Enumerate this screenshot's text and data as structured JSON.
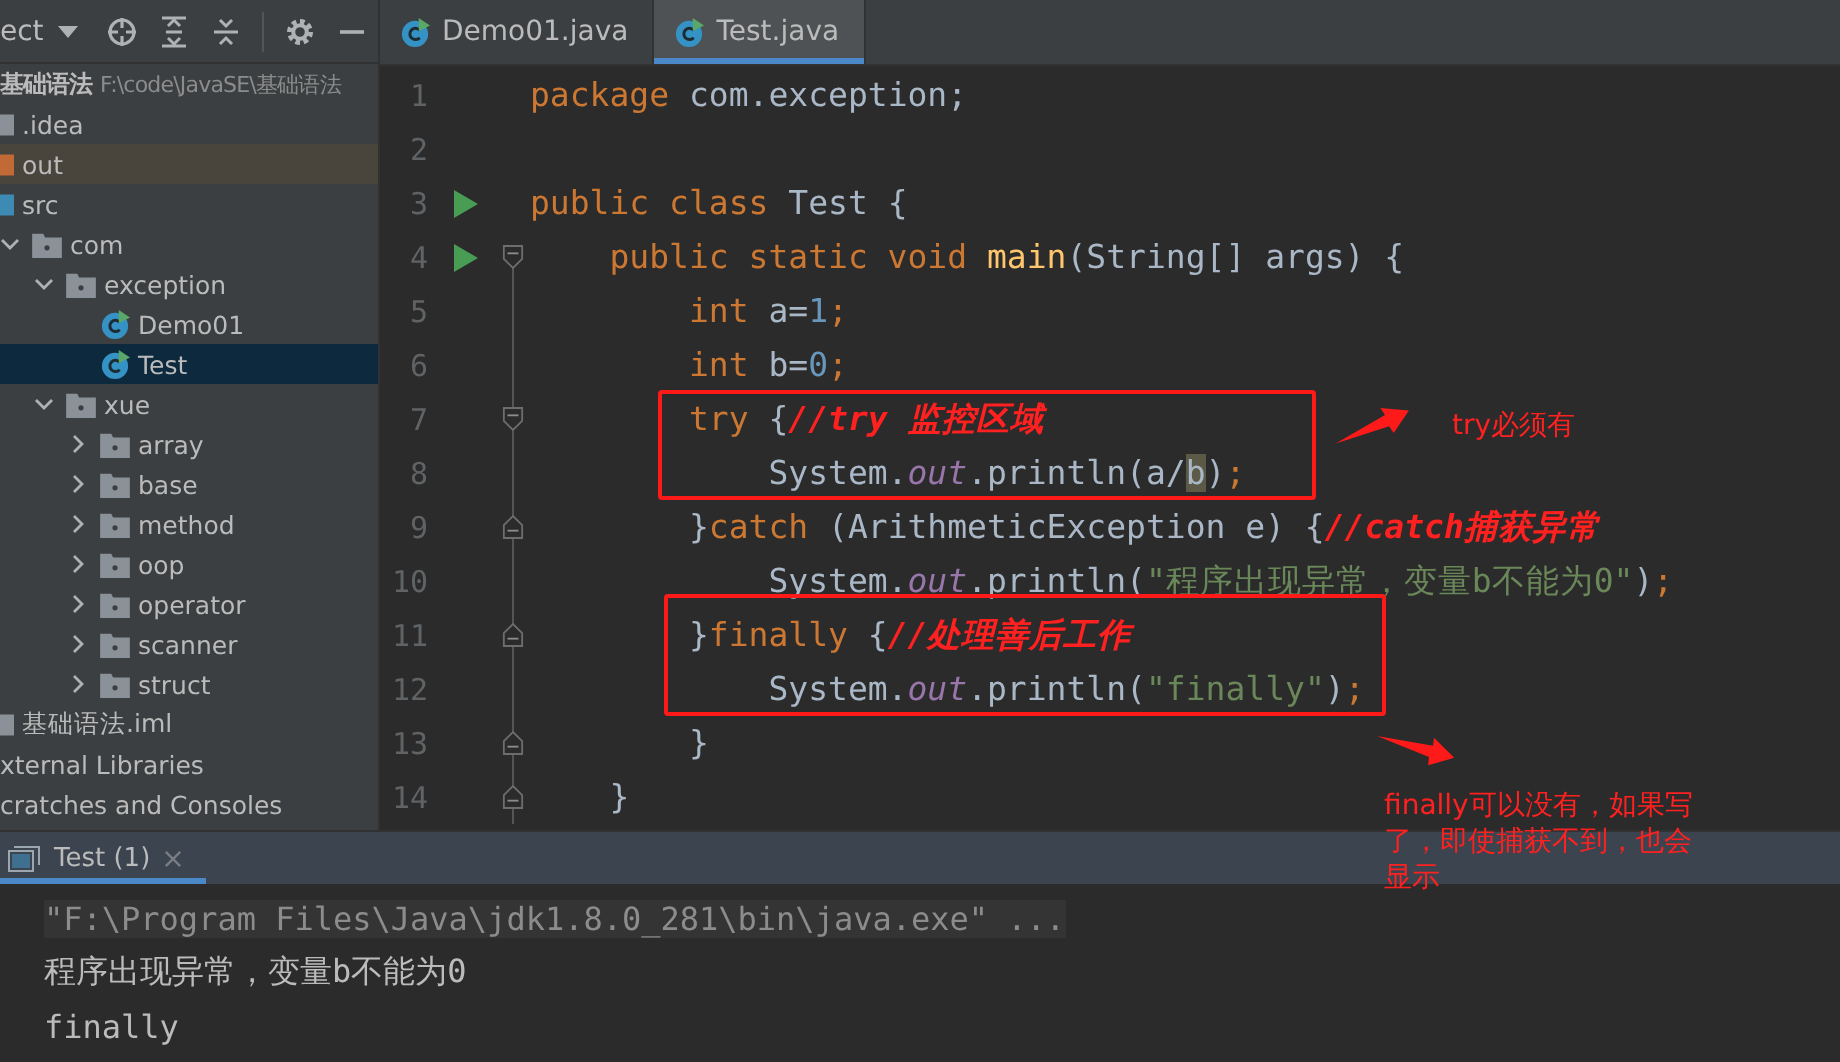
{
  "project_selector": {
    "label": "ect"
  },
  "editor_tabs": [
    {
      "label": "Demo01.java",
      "selected": false
    },
    {
      "label": "Test.java",
      "selected": true
    }
  ],
  "tree": [
    {
      "kind": "project",
      "label": "基础语法",
      "path": "F:\\code\\JavaSE\\基础语法",
      "children": [
        {
          "kind": "folder",
          "label": ".idea",
          "selected": false,
          "highlighted": false
        },
        {
          "kind": "excluded-folder",
          "label": "out",
          "selected": false,
          "highlighted": true
        },
        {
          "kind": "source-folder",
          "label": "src",
          "selected": false,
          "highlighted": false,
          "children": [
            {
              "kind": "package",
              "label": "com",
              "expanded": true,
              "selected": false,
              "highlighted": false,
              "children": [
                {
                  "kind": "package",
                  "label": "exception",
                  "expanded": true,
                  "selected": false,
                  "highlighted": false,
                  "children": [
                    {
                      "kind": "class",
                      "label": "Demo01",
                      "selected": false,
                      "highlighted": false
                    },
                    {
                      "kind": "class",
                      "label": "Test",
                      "selected": true,
                      "highlighted": false
                    }
                  ]
                },
                {
                  "kind": "package",
                  "label": "xue",
                  "expanded": true,
                  "selected": false,
                  "highlighted": false,
                  "children": [
                    {
                      "kind": "package",
                      "label": "array",
                      "expanded": false,
                      "selected": false,
                      "highlighted": false
                    },
                    {
                      "kind": "package",
                      "label": "base",
                      "expanded": false,
                      "selected": false,
                      "highlighted": false
                    },
                    {
                      "kind": "package",
                      "label": "method",
                      "expanded": false,
                      "selected": false,
                      "highlighted": false
                    },
                    {
                      "kind": "package",
                      "label": "oop",
                      "expanded": false,
                      "selected": false,
                      "highlighted": false
                    },
                    {
                      "kind": "package",
                      "label": "operator",
                      "expanded": false,
                      "selected": false,
                      "highlighted": false
                    },
                    {
                      "kind": "package",
                      "label": "scanner",
                      "expanded": false,
                      "selected": false,
                      "highlighted": false
                    },
                    {
                      "kind": "package",
                      "label": "struct",
                      "expanded": false,
                      "selected": false,
                      "highlighted": false
                    }
                  ]
                }
              ]
            }
          ]
        },
        {
          "kind": "iml",
          "label": "基础语法.iml",
          "selected": false,
          "highlighted": false
        }
      ]
    },
    {
      "kind": "plain",
      "label": "xternal Libraries",
      "selected": false,
      "highlighted": false
    },
    {
      "kind": "plain",
      "label": "cratches and Consoles",
      "selected": false,
      "highlighted": false
    }
  ],
  "code_lines": [
    {
      "number": "1",
      "run": false,
      "fold_start": false,
      "fold_end": false,
      "tokens": [
        {
          "kind": "keyword",
          "text": "package"
        },
        {
          "kind": "plain",
          "text": " com.exception;"
        }
      ]
    },
    {
      "number": "2",
      "run": false,
      "fold_start": false,
      "fold_end": false
    },
    {
      "number": "3",
      "run": true,
      "fold_start": false,
      "fold_end": false,
      "tokens": [
        {
          "kind": "keyword",
          "text": "public class"
        },
        {
          "kind": "plain",
          "text": " Test {"
        }
      ]
    },
    {
      "number": "4",
      "run": true,
      "fold_start": true,
      "fold_end": false,
      "tokens": [
        {
          "kind": "keyword",
          "text": "    public static void "
        },
        {
          "kind": "method",
          "text": "main"
        },
        {
          "kind": "plain",
          "text": "(String[] args) {"
        }
      ]
    },
    {
      "number": "5",
      "run": false,
      "fold_start": false,
      "fold_end": false,
      "tokens": [
        {
          "kind": "keyword",
          "text": "        int"
        },
        {
          "kind": "plain",
          "text": " a="
        },
        {
          "kind": "number",
          "text": "1"
        },
        {
          "kind": "keyword",
          "text": ";"
        }
      ]
    },
    {
      "number": "6",
      "run": false,
      "fold_start": false,
      "fold_end": false,
      "tokens": [
        {
          "kind": "keyword",
          "text": "        int"
        },
        {
          "kind": "plain",
          "text": " b="
        },
        {
          "kind": "number",
          "text": "0"
        },
        {
          "kind": "keyword",
          "text": ";"
        }
      ]
    },
    {
      "number": "7",
      "run": false,
      "fold_start": true,
      "fold_end": false,
      "tokens": [
        {
          "kind": "keyword",
          "text": "        try"
        },
        {
          "kind": "plain",
          "text": " {"
        },
        {
          "kind": "note",
          "text": "//try 监控区域"
        }
      ]
    },
    {
      "number": "8",
      "run": false,
      "fold_start": false,
      "fold_end": false,
      "tokens": [
        {
          "kind": "plain",
          "text": "            System."
        },
        {
          "kind": "field",
          "text": "out"
        },
        {
          "kind": "plain",
          "text": ".println(a/"
        },
        {
          "kind": "caret",
          "text": "b"
        },
        {
          "kind": "plain",
          "text": ")"
        },
        {
          "kind": "keyword",
          "text": ";"
        }
      ]
    },
    {
      "number": "9",
      "run": false,
      "fold_start": false,
      "fold_end": true,
      "tokens": [
        {
          "kind": "plain",
          "text": "        }"
        },
        {
          "kind": "keyword",
          "text": "catch"
        },
        {
          "kind": "plain",
          "text": " (ArithmeticException e) {"
        },
        {
          "kind": "note",
          "text": "//catch捕获异常"
        }
      ]
    },
    {
      "number": "10",
      "run": false,
      "fold_start": false,
      "fold_end": false,
      "tokens": [
        {
          "kind": "plain",
          "text": "            System."
        },
        {
          "kind": "field",
          "text": "out"
        },
        {
          "kind": "plain",
          "text": ".println("
        },
        {
          "kind": "string",
          "text": "\"程序出现异常，变量b不能为0\""
        },
        {
          "kind": "plain",
          "text": ")"
        },
        {
          "kind": "keyword",
          "text": ";"
        }
      ]
    },
    {
      "number": "11",
      "run": false,
      "fold_start": false,
      "fold_end": true,
      "tokens": [
        {
          "kind": "plain",
          "text": "        }"
        },
        {
          "kind": "keyword",
          "text": "finally"
        },
        {
          "kind": "plain",
          "text": " {"
        },
        {
          "kind": "note",
          "text": "//处理善后工作"
        }
      ]
    },
    {
      "number": "12",
      "run": false,
      "fold_start": false,
      "fold_end": false,
      "tokens": [
        {
          "kind": "plain",
          "text": "            System."
        },
        {
          "kind": "field",
          "text": "out"
        },
        {
          "kind": "plain",
          "text": ".println("
        },
        {
          "kind": "string",
          "text": "\"finally\""
        },
        {
          "kind": "plain",
          "text": ")"
        },
        {
          "kind": "keyword",
          "text": ";"
        }
      ]
    },
    {
      "number": "13",
      "run": false,
      "fold_start": false,
      "fold_end": true,
      "tokens": [
        {
          "kind": "plain",
          "text": "        }"
        }
      ]
    },
    {
      "number": "14",
      "run": false,
      "fold_start": false,
      "fold_end": true,
      "tokens": [
        {
          "kind": "plain",
          "text": "    }"
        }
      ]
    }
  ],
  "annotations": [
    {
      "note": "try必须有"
    },
    {
      "note": "finally可以没有，如果写了，即使捕获不到，也会显示"
    }
  ],
  "run_tab": {
    "label": "Test (1)",
    "selected": true
  },
  "console_lines": [
    {
      "kind": "command",
      "text": "\"F:\\Program Files\\Java\\jdk1.8.0_281\\bin\\java.exe\" ..."
    },
    {
      "kind": "output",
      "text": "程序出现异常，变量b不能为0"
    },
    {
      "kind": "output",
      "text": "finally"
    }
  ]
}
